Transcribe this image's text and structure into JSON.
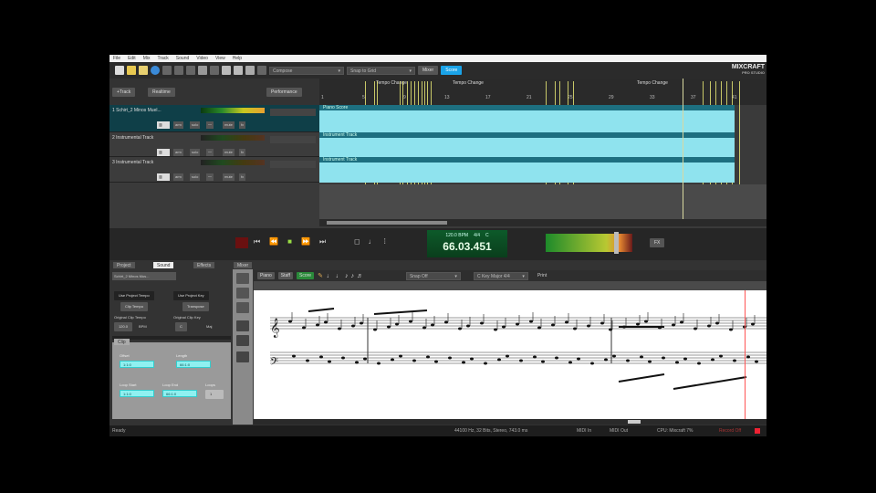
{
  "menu": [
    "File",
    "Edit",
    "Mix",
    "Track",
    "Sound",
    "Video",
    "View",
    "Help"
  ],
  "toolbar": {
    "snap_dropdown": "Compose",
    "grid_dropdown": "Snap to Grid",
    "mixer_button": "Mixer",
    "score_button": "Score",
    "logo": "MIXCRAFT",
    "logo_sub": "PRO STUDIO"
  },
  "header": {
    "add_track": "+Track",
    "mode": "Realtime",
    "performance": "Performance"
  },
  "ruler": {
    "marker": "Tempo Change",
    "bars": [
      "1",
      "5",
      "9",
      "13",
      "17",
      "21",
      "25",
      "29",
      "33",
      "37",
      "41"
    ]
  },
  "tracks": [
    {
      "name": "1 Schirt_2 Minos Muel...",
      "arm": "arm",
      "solo": "solo",
      "mute": "mute",
      "fx": "fx",
      "clip": "Piano Score"
    },
    {
      "name": "2 Instrumental Track",
      "arm": "arm",
      "solo": "solo",
      "mute": "mute",
      "fx": "fx",
      "clip": "Instrument Track"
    },
    {
      "name": "3 Instrumental Track",
      "arm": "arm",
      "solo": "solo",
      "mute": "mute",
      "fx": "fx",
      "clip": "Instrument Track"
    }
  ],
  "transport": {
    "tempo": "120.0 BPM",
    "signature": "4/4",
    "key": "C",
    "time": "66.03.451",
    "fx": "FX"
  },
  "lower": {
    "tabs": [
      "Project",
      "Sound",
      "Effects",
      "Mixer"
    ],
    "clip_name": "Schirt_2 Minos Mus...",
    "use_tempo": "Use Project Tempo",
    "use_key": "Use Project Key",
    "follow_tempo": "Clip Tempo",
    "follow_key": "Transpose",
    "orig_tempo_label": "Original Clip Tempo",
    "orig_tempo": "120.0",
    "bpm": "BPM",
    "orig_key_label": "Original Clip Key",
    "orig_key": "C",
    "maj": "Maj",
    "subtab": "Clip",
    "offset_label": "Offset",
    "offset": "1:1:0",
    "length_label": "Length",
    "length": "66:1:0",
    "loop_start_label": "Loop Start",
    "loop_start": "1:1:0",
    "loop_end_label": "Loop End",
    "loop_end": "66:1:0",
    "loops_label": "Loops",
    "loops": "1"
  },
  "score_toolbar": {
    "piano": "Piano",
    "staff": "Staff",
    "score": "Score",
    "snap": "Snap Off",
    "key": "C Key Major 4/4",
    "print": "Print"
  },
  "status": {
    "left": "Ready",
    "format": "44100 Hz, 32 Bits, Stereo, 743.0 ms",
    "midi_in": "MIDI In",
    "midi_out": "MIDI Out",
    "cpu": "CPU: Mixcraft 7%",
    "record": "Record Off"
  }
}
